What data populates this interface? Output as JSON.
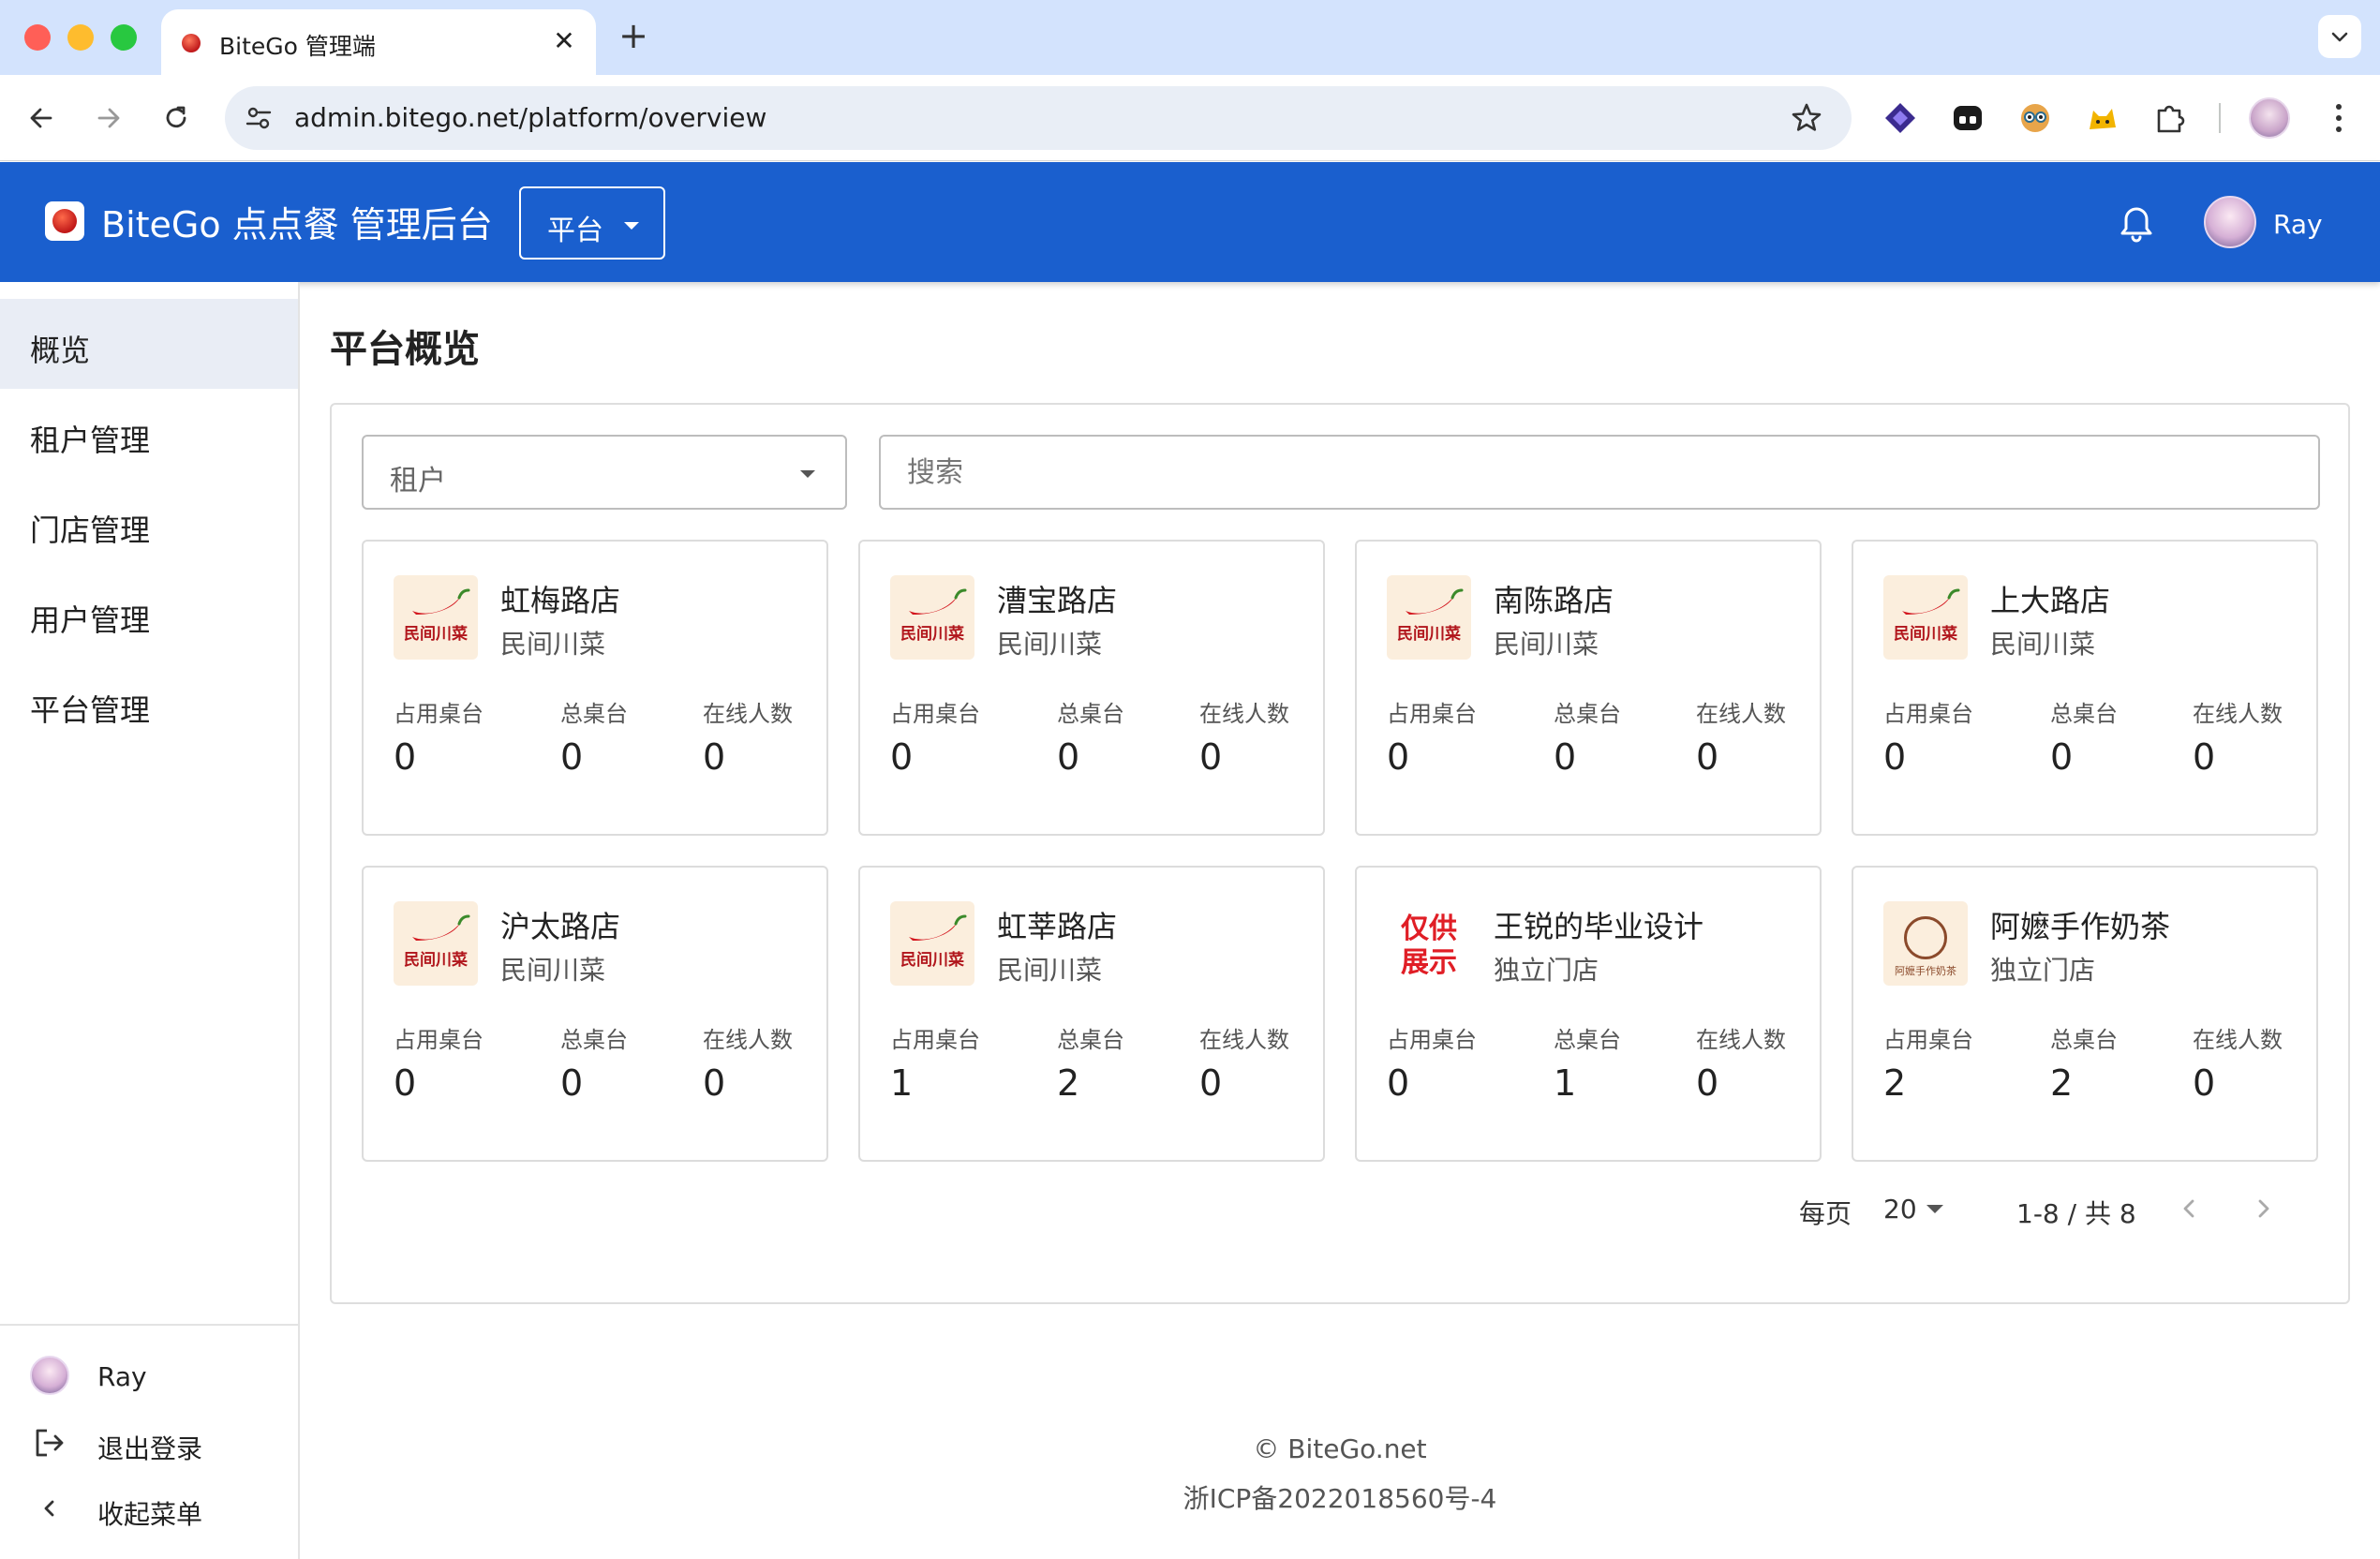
{
  "browser": {
    "tab_title": "BiteGo 管理端",
    "url": "admin.bitego.net/platform/overview",
    "tab_close": "✕",
    "new_tab": "+"
  },
  "header": {
    "title": "BiteGo 点点餐 管理后台",
    "scope": "平台",
    "user": "Ray"
  },
  "sidebar": {
    "items": [
      {
        "label": "概览",
        "active": true
      },
      {
        "label": "租户管理",
        "active": false
      },
      {
        "label": "门店管理",
        "active": false
      },
      {
        "label": "用户管理",
        "active": false
      },
      {
        "label": "平台管理",
        "active": false
      }
    ],
    "user": "Ray",
    "logout": "退出登录",
    "collapse": "收起菜单"
  },
  "main": {
    "title": "平台概览",
    "tenant_placeholder": "租户",
    "search_placeholder": "搜索",
    "stat_labels": [
      "占用桌台",
      "总桌台",
      "在线人数"
    ],
    "stores": [
      {
        "name": "虹梅路店",
        "type": "民间川菜",
        "logo": "民间川菜",
        "occupied": "0",
        "total": "0",
        "online": "0"
      },
      {
        "name": "漕宝路店",
        "type": "民间川菜",
        "logo": "民间川菜",
        "occupied": "0",
        "total": "0",
        "online": "0"
      },
      {
        "name": "南陈路店",
        "type": "民间川菜",
        "logo": "民间川菜",
        "occupied": "0",
        "total": "0",
        "online": "0"
      },
      {
        "name": "上大路店",
        "type": "民间川菜",
        "logo": "民间川菜",
        "occupied": "0",
        "total": "0",
        "online": "0"
      },
      {
        "name": "沪太路店",
        "type": "民间川菜",
        "logo": "民间川菜",
        "occupied": "0",
        "total": "0",
        "online": "0"
      },
      {
        "name": "虹莘路店",
        "type": "民间川菜",
        "logo": "民间川菜",
        "occupied": "1",
        "total": "2",
        "online": "0"
      },
      {
        "name": "王锐的毕业设计",
        "type": "独立门店",
        "logo": "仅供展示",
        "occupied": "0",
        "total": "1",
        "online": "0"
      },
      {
        "name": "阿嬷手作奶茶",
        "type": "独立门店",
        "logo": "阿嬷手作奶茶",
        "occupied": "2",
        "total": "2",
        "online": "0"
      }
    ],
    "pager": {
      "per_page_label": "每页",
      "per_page": "20",
      "range": "1-8 / 共 8"
    }
  },
  "footer": {
    "copyright": "© BiteGo.net",
    "icp": "浙ICP备2022018560号-4"
  },
  "colors": {
    "header_bg": "#1a5fce",
    "tabbar_bg": "#d3e3fd",
    "sidebar_active": "#e9edf5",
    "brand_red": "#c01818"
  },
  "icons": [
    "back-icon",
    "forward-icon",
    "reload-icon",
    "site-info-icon",
    "bookmark-star-icon",
    "bell-icon",
    "logout-icon",
    "chevron-left-icon",
    "chevron-right-icon",
    "caret-down-icon"
  ]
}
